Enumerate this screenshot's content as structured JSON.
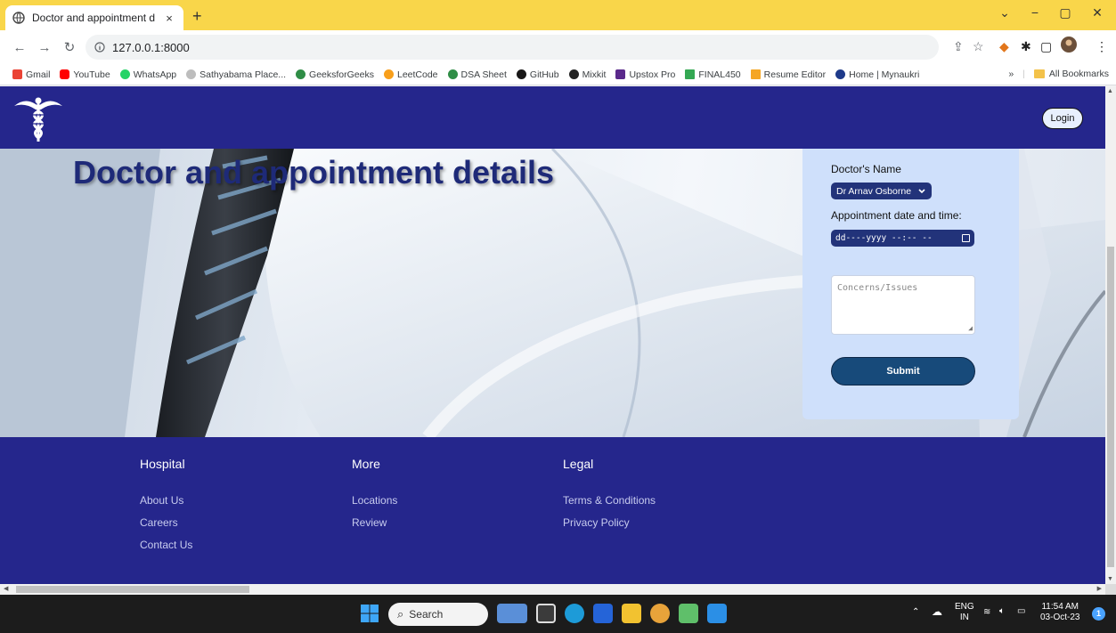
{
  "browser": {
    "tab_title": "Doctor and appointment details",
    "tab_close": "×",
    "new_tab": "+",
    "url": "127.0.0.1:8000",
    "window_controls": {
      "dropdown": "⌄",
      "minimize": "−",
      "maximize": "▢",
      "close": "✕"
    },
    "bookmarks": [
      {
        "label": "Gmail",
        "color": "#ea4335"
      },
      {
        "label": "YouTube",
        "color": "#ff0000"
      },
      {
        "label": "WhatsApp",
        "color": "#25d366"
      },
      {
        "label": "Sathyabama Place...",
        "color": "#9e9e9e"
      },
      {
        "label": "GeeksforGeeks",
        "color": "#2f8d46"
      },
      {
        "label": "LeetCode",
        "color": "#f89f1b"
      },
      {
        "label": "DSA Sheet",
        "color": "#2f8d46"
      },
      {
        "label": "GitHub",
        "color": "#181717"
      },
      {
        "label": "Mixkit",
        "color": "#222222"
      },
      {
        "label": "Upstox Pro",
        "color": "#5a298b"
      },
      {
        "label": "FINAL450",
        "color": "#34a853"
      },
      {
        "label": "Resume Editor",
        "color": "#f5a623"
      },
      {
        "label": "Home | Mynaukri",
        "color": "#1e3a8a"
      }
    ],
    "more_bookmarks": "»",
    "all_bookmarks": "All Bookmarks"
  },
  "header": {
    "login_label": "Login"
  },
  "hero": {
    "title": "Doctor and appointment details"
  },
  "form": {
    "doctor_label": "Doctor's Name",
    "doctor_selected": "Dr Arnav Osborne",
    "datetime_label": "Appointment date and time:",
    "datetime_placeholder": "dd----yyyy --:-- --",
    "concerns_placeholder": "Concerns/Issues",
    "submit_label": "Submit"
  },
  "footer": {
    "columns": [
      {
        "heading": "Hospital",
        "links": [
          "About Us",
          "Careers",
          "Contact Us"
        ]
      },
      {
        "heading": "More",
        "links": [
          "Locations",
          "Review"
        ]
      },
      {
        "heading": "Legal",
        "links": [
          "Terms & Conditions",
          "Privacy Policy"
        ]
      }
    ]
  },
  "taskbar": {
    "search_label": "Search",
    "language_top": "ENG",
    "language_bottom": "IN",
    "time": "11:54 AM",
    "date": "03-Oct-23",
    "notification_count": "1"
  },
  "colors": {
    "header_bg": "#25268c",
    "form_bg": "#cfe0fb",
    "submit_bg": "#174a7a",
    "tabstrip_bg": "#f9d64a"
  }
}
